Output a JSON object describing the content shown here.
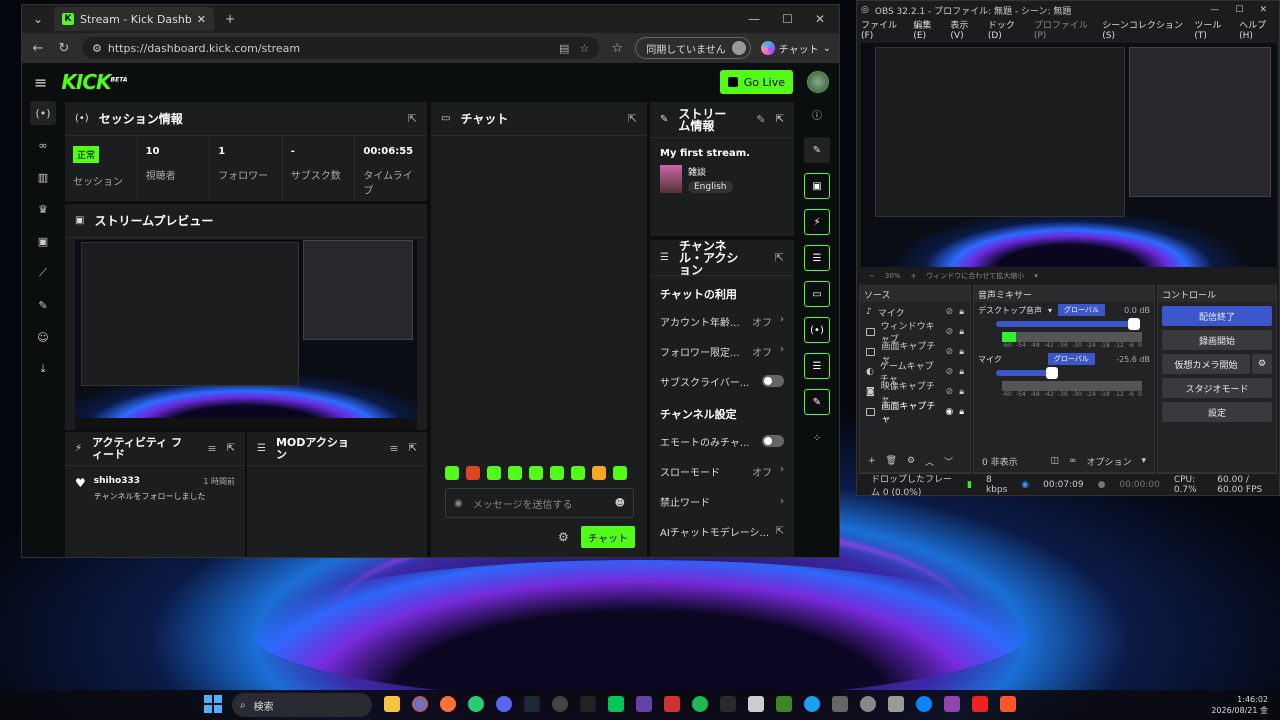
{
  "browser": {
    "tab_title": "Stream - Kick Dashboard",
    "url": "https://dashboard.kick.com/stream",
    "sync_label": "同期していません",
    "copilot_label": "チャット"
  },
  "kick": {
    "logo": "KICK",
    "logo_beta": "BETA",
    "go_live": "Go Live",
    "session": {
      "title": "セッション情報",
      "status_badge": "正常",
      "stats": [
        {
          "value": "",
          "label": "セッション"
        },
        {
          "value": "10",
          "label": "視聴者"
        },
        {
          "value": "1",
          "label": "フォロワー"
        },
        {
          "value": "-",
          "label": "サブスク数"
        },
        {
          "value": "00:06:55",
          "label": "タイムライブ"
        }
      ]
    },
    "preview_title": "ストリームプレビュー",
    "activity": {
      "title": "アクティビティ フィード",
      "items": [
        {
          "user": "shiho333",
          "text": "チャンネルをフォローしました",
          "time": "1 時間前"
        }
      ]
    },
    "mod_title": "MODアクション",
    "chat": {
      "title": "チャット",
      "placeholder": "メッセージを送信する",
      "send": "チャット"
    },
    "stream_info": {
      "title": "ストリーム情報",
      "stream_title": "My first stream.",
      "category": "雑談",
      "language": "English"
    },
    "channel_actions": {
      "title": "チャンネル・アクション",
      "chat_section": "チャットの利用",
      "chat_rows": [
        {
          "label": "アカウント年齢...",
          "value": "オフ"
        },
        {
          "label": "フォロワー限定...",
          "value": "オフ"
        },
        {
          "label": "サブスクライバー..."
        }
      ],
      "channel_section": "チャンネル設定",
      "channel_rows": [
        {
          "label": "エモートのみチャ..."
        },
        {
          "label": "スローモード",
          "value": "オフ"
        },
        {
          "label": "禁止ワード"
        },
        {
          "label": "AIチャットモデレーシ..."
        }
      ]
    }
  },
  "obs": {
    "title": "OBS 32.2.1 - プロファイル: 無題 - シーン: 無題",
    "menu": [
      "ファイル(F)",
      "編集(E)",
      "表示(V)",
      "ドック(D)",
      "プロファイル(P)",
      "シーンコレクション(S)",
      "ツール(T)",
      "ヘルプ(H)"
    ],
    "zoom": "30%",
    "zoom_fit": "ウィンドウに合わせて拡大縮小",
    "sources_title": "ソース",
    "sources": [
      "マイク",
      "ウィンドウキャプ",
      "画面キャプチャ",
      "ゲームキャプチャ",
      "映像キャプチャ",
      "画面キャプチャ"
    ],
    "mixer_title": "音声ミキサー",
    "mixer": [
      {
        "name": "デスクトップ音声",
        "tag": "グローバル",
        "db": "0.0 dB",
        "level": 1.0
      },
      {
        "name": "マイク",
        "tag": "グローバル",
        "db": "-25.6 dB",
        "level": 0.45
      }
    ],
    "meter_ticks": [
      "-60",
      "-54",
      "-48",
      "-42",
      "-36",
      "-30",
      "-24",
      "-18",
      "-12",
      "-6",
      "0"
    ],
    "hidden_label": "0 非表示",
    "options_label": "オプション",
    "controls_title": "コントロール",
    "controls": [
      "配信終了",
      "録画開始",
      "仮想カメラ開始",
      "スタジオモード",
      "設定"
    ],
    "status": {
      "dropped": "ドロップしたフレーム 0 (0.0%)",
      "kbps": "8 kbps",
      "stream_time": "00:07:09",
      "rec_time": "00:00:00",
      "cpu": "CPU: 0.7%",
      "fps": "60.00 / 60.00 FPS"
    }
  },
  "taskbar": {
    "search": "検索",
    "time": "1:46:02",
    "date": "2026/08/21 金"
  },
  "colors": {
    "kick_green": "#53fc18",
    "obs_blue": "#3c57c9"
  }
}
